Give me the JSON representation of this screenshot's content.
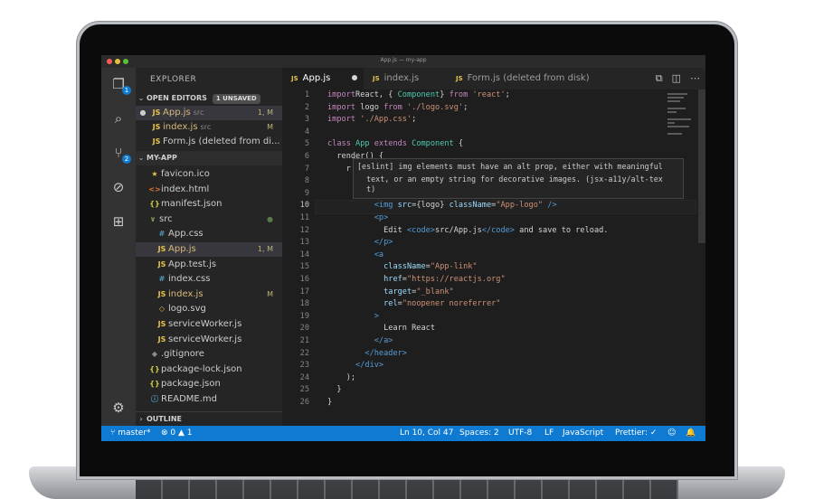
{
  "window": {
    "title": "App.js — my-app"
  },
  "activity": {
    "explorer_badge": "1",
    "scm_badge": "2"
  },
  "sidebar": {
    "title": "EXPLORER",
    "open_editors": {
      "label": "OPEN EDITORS",
      "unsaved": "1 UNSAVED",
      "items": [
        {
          "icon": "JS",
          "name": "App.js",
          "path": "src",
          "status": "1, M"
        },
        {
          "icon": "JS",
          "name": "index.js",
          "path": "src",
          "status": "M"
        },
        {
          "icon": "JS",
          "name": "Form.js (deleted from di...",
          "path": "",
          "status": ""
        }
      ]
    },
    "folder": {
      "label": "MY-APP",
      "items": [
        {
          "icon": "★",
          "name": "favicon.ico",
          "status": ""
        },
        {
          "icon": "<>",
          "name": "index.html",
          "status": ""
        },
        {
          "icon": "{}",
          "name": "manifest.json",
          "status": ""
        },
        {
          "icon": "∨",
          "name": "src",
          "status": "●"
        },
        {
          "icon": "#",
          "name": "App.css",
          "status": ""
        },
        {
          "icon": "JS",
          "name": "App.js",
          "status": "1, M"
        },
        {
          "icon": "JS",
          "name": "App.test.js",
          "status": ""
        },
        {
          "icon": "#",
          "name": "index.css",
          "status": ""
        },
        {
          "icon": "JS",
          "name": "index.js",
          "status": "M"
        },
        {
          "icon": "◇",
          "name": "logo.svg",
          "status": ""
        },
        {
          "icon": "JS",
          "name": "serviceWorker.js",
          "status": ""
        },
        {
          "icon": "JS",
          "name": "serviceWorker.js",
          "status": ""
        },
        {
          "icon": "◆",
          "name": ".gitignore",
          "status": ""
        },
        {
          "icon": "{}",
          "name": "package-lock.json",
          "status": ""
        },
        {
          "icon": "{}",
          "name": "package.json",
          "status": ""
        },
        {
          "icon": "ⓘ",
          "name": "README.md",
          "status": ""
        }
      ]
    },
    "outline": "OUTLINE"
  },
  "tabs": [
    {
      "icon": "JS",
      "label": "App.js",
      "dirty": true
    },
    {
      "icon": "JS",
      "label": "index.js",
      "dirty": false
    },
    {
      "icon": "JS",
      "label": "Form.js (deleted from disk)",
      "dirty": false
    }
  ],
  "tab_actions": [
    "⧉",
    "◫",
    "⋯"
  ],
  "editor": {
    "line_numbers": [
      "1",
      "2",
      "3",
      "4",
      "5",
      "6",
      "7",
      "8",
      "9",
      "10",
      "11",
      "12",
      "13",
      "14",
      "15",
      "16",
      "17",
      "18",
      "19",
      "20",
      "21",
      "22",
      "23",
      "24",
      "25",
      "26"
    ],
    "current_line": "10",
    "hover": {
      "line1": "[eslint] img elements must have an alt prop, either with meaningful",
      "line2": "  text, or an empty string for decorative images. (jsx-a11y/alt-tex",
      "line3": "  t)"
    },
    "code": [
      [
        [
          "kw",
          "import"
        ],
        [
          "",
          "React, { "
        ],
        [
          "cls",
          "Component"
        ],
        [
          "",
          ""
        ],
        [
          "",
          "} "
        ],
        [
          "kw",
          "from "
        ],
        [
          "str",
          "'react'"
        ],
        [
          "",
          ";"
        ]
      ],
      [
        [
          "kw",
          "import"
        ],
        [
          "",
          " logo "
        ],
        [
          "kw",
          "from "
        ],
        [
          "str",
          "'./logo.svg'"
        ],
        [
          "",
          ";"
        ]
      ],
      [
        [
          "kw",
          "import "
        ],
        [
          "str",
          "'./App.css'"
        ],
        [
          "",
          ";"
        ]
      ],
      [],
      [
        [
          "kw",
          "class "
        ],
        [
          "cls",
          "App "
        ],
        [
          "kw",
          "extends "
        ],
        [
          "cls",
          "Component"
        ],
        [
          "",
          " {"
        ]
      ],
      [
        [
          "",
          "  render() {"
        ]
      ],
      [
        [
          "",
          "    r"
        ]
      ],
      [],
      [],
      [
        [
          "",
          "          "
        ],
        [
          "tag",
          "<img "
        ],
        [
          "attr",
          "src"
        ],
        [
          "",
          "={logo} "
        ],
        [
          "attr",
          "className"
        ],
        [
          "",
          "="
        ],
        [
          "str",
          "\"App-logo\""
        ],
        [
          "",
          " "
        ],
        [
          "tag",
          "/>"
        ]
      ],
      [
        [
          "",
          "          "
        ],
        [
          "tag",
          "<p>"
        ]
      ],
      [
        [
          "",
          "            Edit "
        ],
        [
          "tag",
          "<code>"
        ],
        [
          "",
          "src/App.js"
        ],
        [
          "tag",
          "</code>"
        ],
        [
          "",
          " and save to reload."
        ]
      ],
      [
        [
          "",
          "          "
        ],
        [
          "tag",
          "</p>"
        ]
      ],
      [
        [
          "",
          "          "
        ],
        [
          "tag",
          "<a"
        ]
      ],
      [
        [
          "",
          "            "
        ],
        [
          "attr",
          "className"
        ],
        [
          "",
          "="
        ],
        [
          "str",
          "\"App-link\""
        ]
      ],
      [
        [
          "",
          "            "
        ],
        [
          "attr",
          "href"
        ],
        [
          "",
          "="
        ],
        [
          "str",
          "\"https://reactjs.org\""
        ]
      ],
      [
        [
          "",
          "            "
        ],
        [
          "attr",
          "target"
        ],
        [
          "",
          "="
        ],
        [
          "str",
          "\"_blank\""
        ]
      ],
      [
        [
          "",
          "            "
        ],
        [
          "attr",
          "rel"
        ],
        [
          "",
          "="
        ],
        [
          "str",
          "\"noopener noreferrer\""
        ]
      ],
      [
        [
          "",
          "          "
        ],
        [
          "tag",
          ">"
        ]
      ],
      [
        [
          "",
          "            Learn React"
        ]
      ],
      [
        [
          "",
          "          "
        ],
        [
          "tag",
          "</a>"
        ]
      ],
      [
        [
          "",
          "        "
        ],
        [
          "tag",
          "</header>"
        ]
      ],
      [
        [
          "",
          "      "
        ],
        [
          "tag",
          "</div>"
        ]
      ],
      [
        [
          "",
          "    );"
        ]
      ],
      [
        [
          "",
          "  }"
        ]
      ],
      [
        [
          "",
          "}"
        ]
      ]
    ]
  },
  "status": {
    "branch": "master*",
    "problems": "⊗ 0 ▲ 1",
    "position": "Ln 10, Col 47",
    "spaces": "Spaces: 2",
    "encoding": "UTF-8",
    "eol": "LF",
    "language": "JavaScript",
    "formatter": "Prettier: ✓",
    "feedback": "☺",
    "bell": "🔔"
  },
  "colors": {
    "status_bar": "#0e7ad1",
    "sidebar": "#252526",
    "editor": "#1e1e1e",
    "activity_bar": "#333333",
    "js_icon": "#e8c44b",
    "modified": "#d7ba7d"
  }
}
